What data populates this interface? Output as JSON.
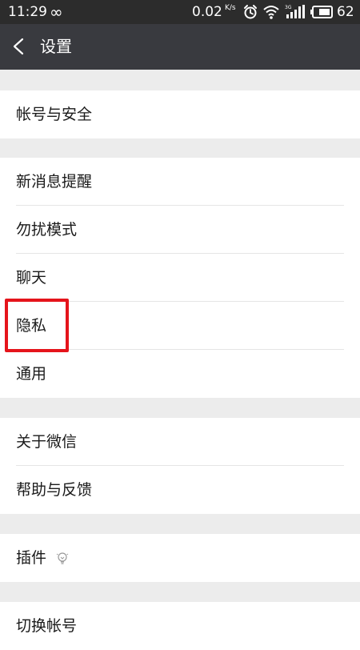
{
  "status_bar": {
    "time": "11:29",
    "infinity_symbol": "∞",
    "speed": "0.02",
    "speed_unit": "K/s",
    "battery_level": "62",
    "icons": [
      "alarm-icon",
      "wifi-icon",
      "signal-3g-icon",
      "battery-icon"
    ]
  },
  "header": {
    "title": "设置",
    "back_icon": "chevron-left-icon"
  },
  "groups": [
    {
      "items": [
        {
          "label": "帐号与安全"
        }
      ]
    },
    {
      "items": [
        {
          "label": "新消息提醒"
        },
        {
          "label": "勿扰模式"
        },
        {
          "label": "聊天"
        },
        {
          "label": "隐私"
        },
        {
          "label": "通用"
        }
      ]
    },
    {
      "items": [
        {
          "label": "关于微信"
        },
        {
          "label": "帮助与反馈"
        }
      ]
    },
    {
      "items": [
        {
          "label": "插件",
          "icon": "lightbulb-icon"
        }
      ]
    },
    {
      "items": [
        {
          "label": "切换帐号"
        }
      ]
    }
  ],
  "colors": {
    "status_bar": "#2c2c2c",
    "app_bar": "#393a3f",
    "page_background": "#ececec",
    "highlight": "#e5141b"
  }
}
